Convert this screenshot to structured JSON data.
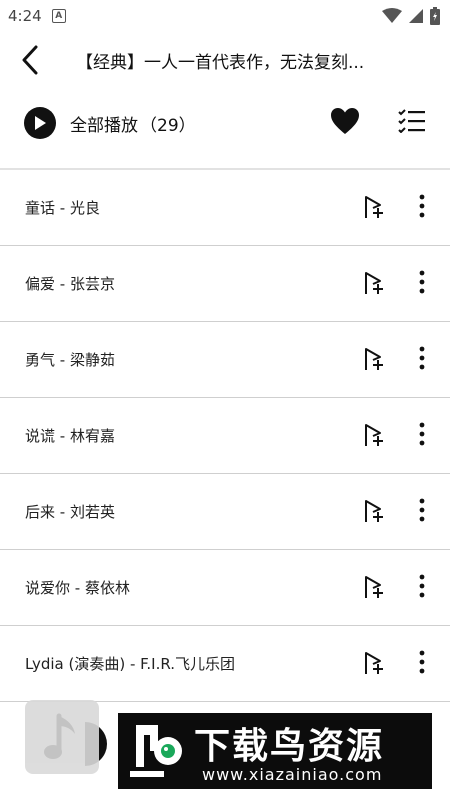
{
  "status_bar": {
    "time": "4:24",
    "notification_letter": "A"
  },
  "header": {
    "title": "【经典】一人一首代表作，无法复刻..."
  },
  "play_all": {
    "label": "全部播放",
    "count": "（29）"
  },
  "songs": [
    {
      "title": "童话 - 光良"
    },
    {
      "title": "偏爱 - 张芸京"
    },
    {
      "title": "勇气 - 梁静茹"
    },
    {
      "title": "说谎 - 林宥嘉"
    },
    {
      "title": "后来 - 刘若英"
    },
    {
      "title": "说爱你 - 蔡依林"
    },
    {
      "title": "Lydia (演奏曲) - F.I.R.飞儿乐团"
    }
  ],
  "watermark": {
    "name": "下载鸟资源",
    "url": "www.xiazainiao.com"
  },
  "icons": {
    "back": "chevron-left-icon",
    "play": "play-icon",
    "favorite": "heart-icon",
    "multi_select": "checklist-icon",
    "add_to_playlist": "add-to-playlist-icon",
    "more": "more-vertical-icon"
  },
  "colors": {
    "primary_text": "#111111",
    "divider": "#cfcfcf",
    "watermark_bg": "#0c0c0c"
  }
}
